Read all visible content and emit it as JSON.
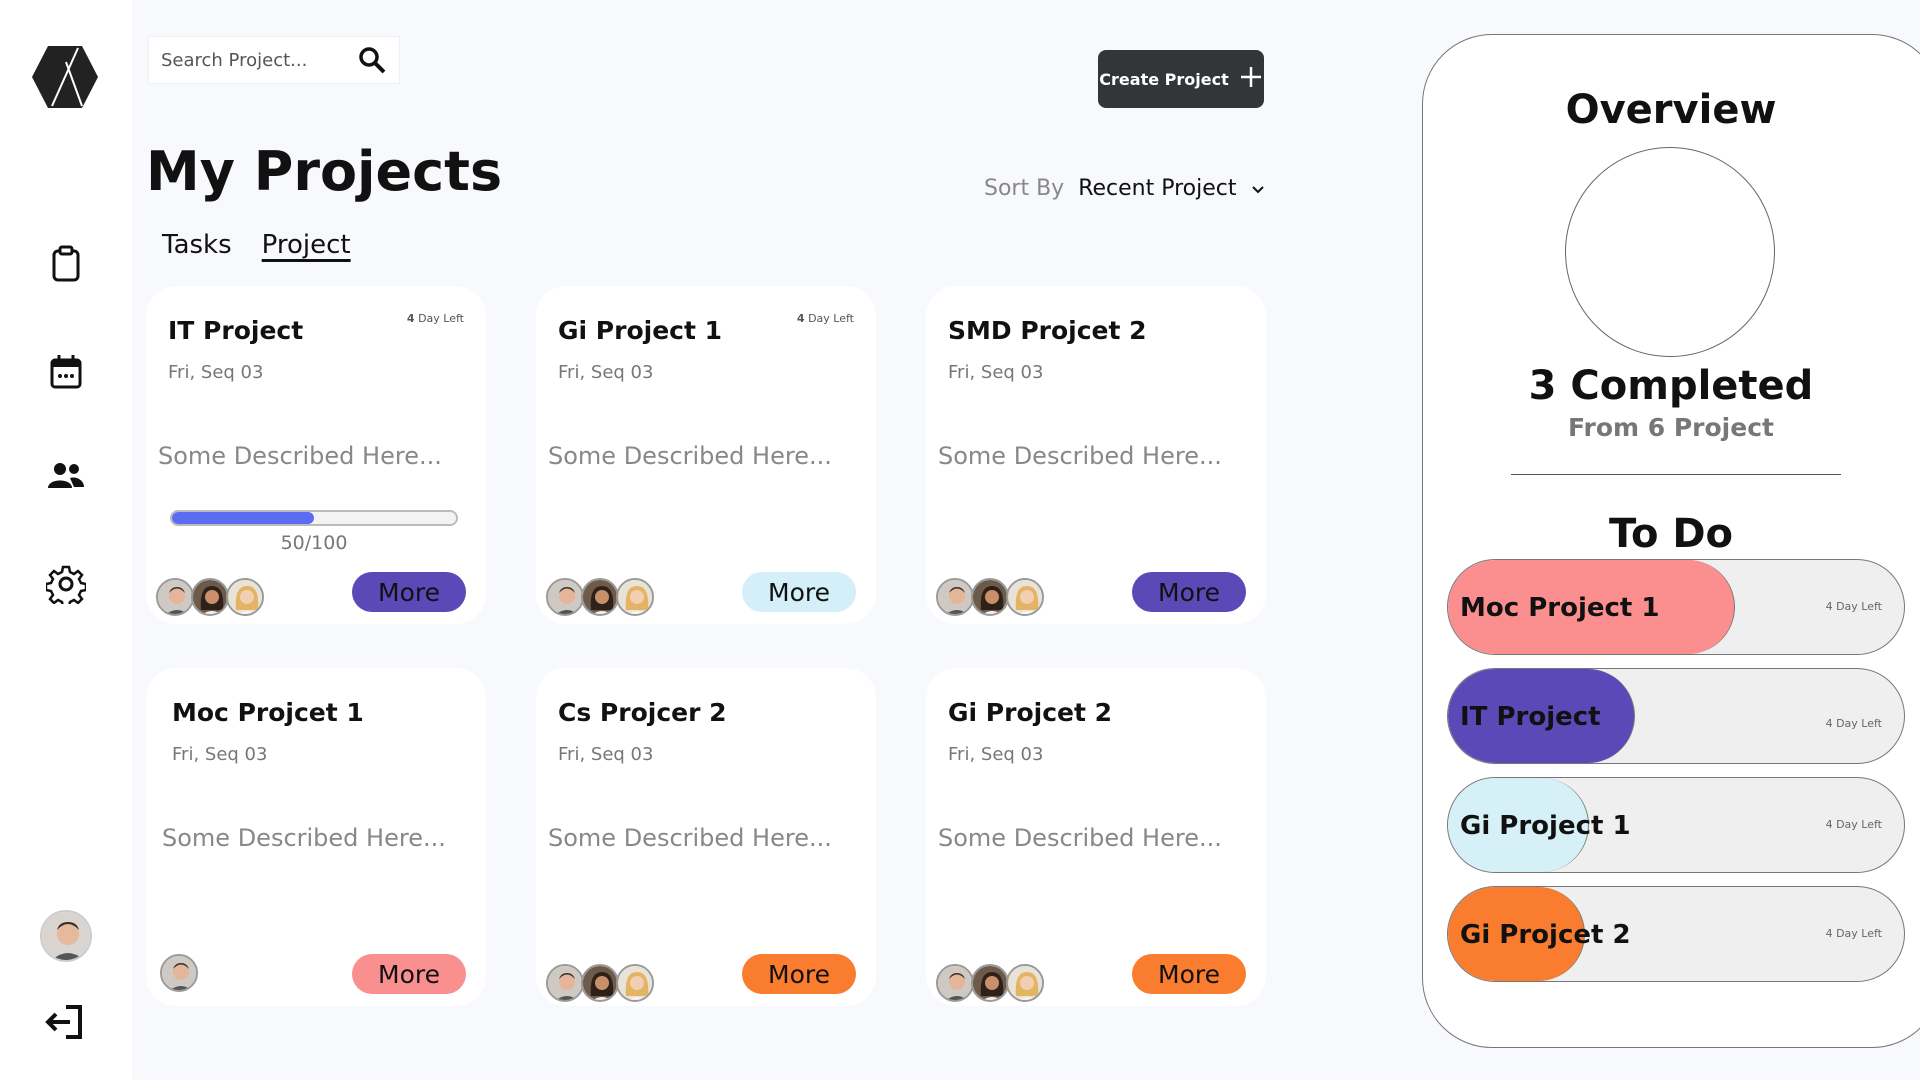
{
  "search": {
    "placeholder": "Search Project..."
  },
  "header": {
    "create_label": "Create Project",
    "title": "My Projects",
    "sort_label": "Sort By",
    "sort_value": "Recent Project"
  },
  "tabs": [
    {
      "label": "Tasks",
      "active": false
    },
    {
      "label": "Project",
      "active": true
    }
  ],
  "cards": [
    {
      "title": "IT Project",
      "days_left_num": "4",
      "days_left_text": "Day Left",
      "date": "Fri, Seq 03",
      "desc": "Some Described Here...",
      "progress": "50/100",
      "more": "More",
      "more_color": "#5b49b8"
    },
    {
      "title": "Gi Project 1",
      "days_left_num": "4",
      "days_left_text": "Day Left",
      "date": "Fri, Seq 03",
      "desc": "Some Described Here...",
      "more": "More",
      "more_color": "#d4eff7"
    },
    {
      "title": "SMD Projcet 2",
      "date": "Fri, Seq 03",
      "desc": "Some Described Here...",
      "more": "More",
      "more_color": "#5b49b8"
    },
    {
      "title": "Moc Projcet 1",
      "date": "Fri, Seq 03",
      "desc": "Some Described Here...",
      "more": "More",
      "more_color": "#fa8f8f"
    },
    {
      "title": "Cs Projcer 2",
      "date": "Fri, Seq 03",
      "desc": "Some Described Here...",
      "more": "More",
      "more_color": "#fa7c2e"
    },
    {
      "title": "Gi Projcet 2",
      "date": "Fri, Seq 03",
      "desc": "Some Described Here...",
      "more": "More",
      "more_color": "#fa7c2e"
    }
  ],
  "overview": {
    "title": "Overview",
    "completed": "3 Completed",
    "from": "From 6 Project",
    "todo_title": "To Do",
    "todo": [
      {
        "name": "Moc Project 1",
        "days": "4 Day Left",
        "color": "#fb8f8f",
        "fill": 0.78
      },
      {
        "name": "IT Project",
        "days": "4 Day Left",
        "color": "#5b49b8",
        "fill": 0.5
      },
      {
        "name": "Gi Project 1",
        "days": "4 Day Left",
        "color": "#d6f0f8",
        "fill": 0.38
      },
      {
        "name": "Gi Projcet 2",
        "days": "4 Day Left",
        "color": "#fa7c2e",
        "fill": 0.37
      }
    ]
  },
  "icons": [
    "logo-icon",
    "clipboard-icon",
    "calendar-icon",
    "people-icon",
    "gear-icon",
    "user-avatar",
    "logout-icon",
    "search-icon",
    "plus-icon",
    "chevron-down-icon"
  ]
}
